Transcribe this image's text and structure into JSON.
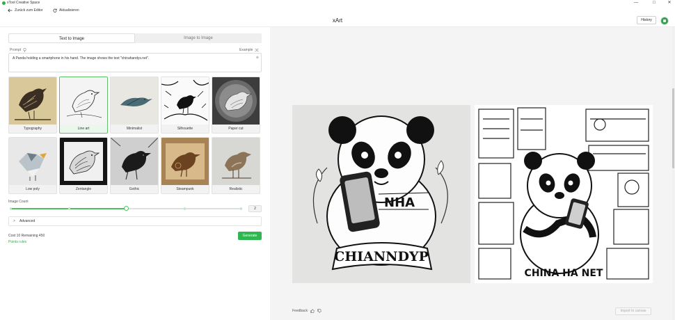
{
  "window": {
    "title": "xTool Creative Space",
    "controls": {
      "minimize": "—",
      "maximize": "□",
      "close": "✕"
    }
  },
  "toolbar": {
    "back_label": "Zurück zum Editor",
    "refresh_label": "Aktualisieren"
  },
  "header": {
    "title": "xArt",
    "history_label": "History"
  },
  "tabs": [
    {
      "label": "Text to Image",
      "active": true
    },
    {
      "label": "Image to Image",
      "active": false
    }
  ],
  "prompt": {
    "label": "Prompt",
    "example_label": "Example",
    "value": "A Panda holding a smartphone in his hand. The image shows the text \"chinahandys.net\".",
    "clear": "⊗"
  },
  "styles": [
    {
      "label": "Typography",
      "selected": false
    },
    {
      "label": "Line art",
      "selected": true
    },
    {
      "label": "Minimalist",
      "selected": false
    },
    {
      "label": "Silhouette",
      "selected": false
    },
    {
      "label": "Paper cut",
      "selected": false
    },
    {
      "label": "Low poly",
      "selected": false
    },
    {
      "label": "Zentangle",
      "selected": false
    },
    {
      "label": "Gothic",
      "selected": false
    },
    {
      "label": "Steampunk",
      "selected": false
    },
    {
      "label": "Realistic",
      "selected": false
    }
  ],
  "image_count": {
    "label": "Image Count",
    "value": "2",
    "fraction": 0.5
  },
  "advanced": {
    "label": "Advanced",
    "chevron": ">"
  },
  "footer": {
    "cost_text": "Cost 10 Remaining 450",
    "points_rules": "Points rules",
    "generate_label": "Generate"
  },
  "results": {
    "image1_text": "CHIANNDYP",
    "image2_text": "CHINA HA NET",
    "feedback_label": "Feedback",
    "import_label": "Import to canvas"
  },
  "colors": {
    "accent": "#2fb650",
    "panel_bg": "#f3f4f3"
  }
}
